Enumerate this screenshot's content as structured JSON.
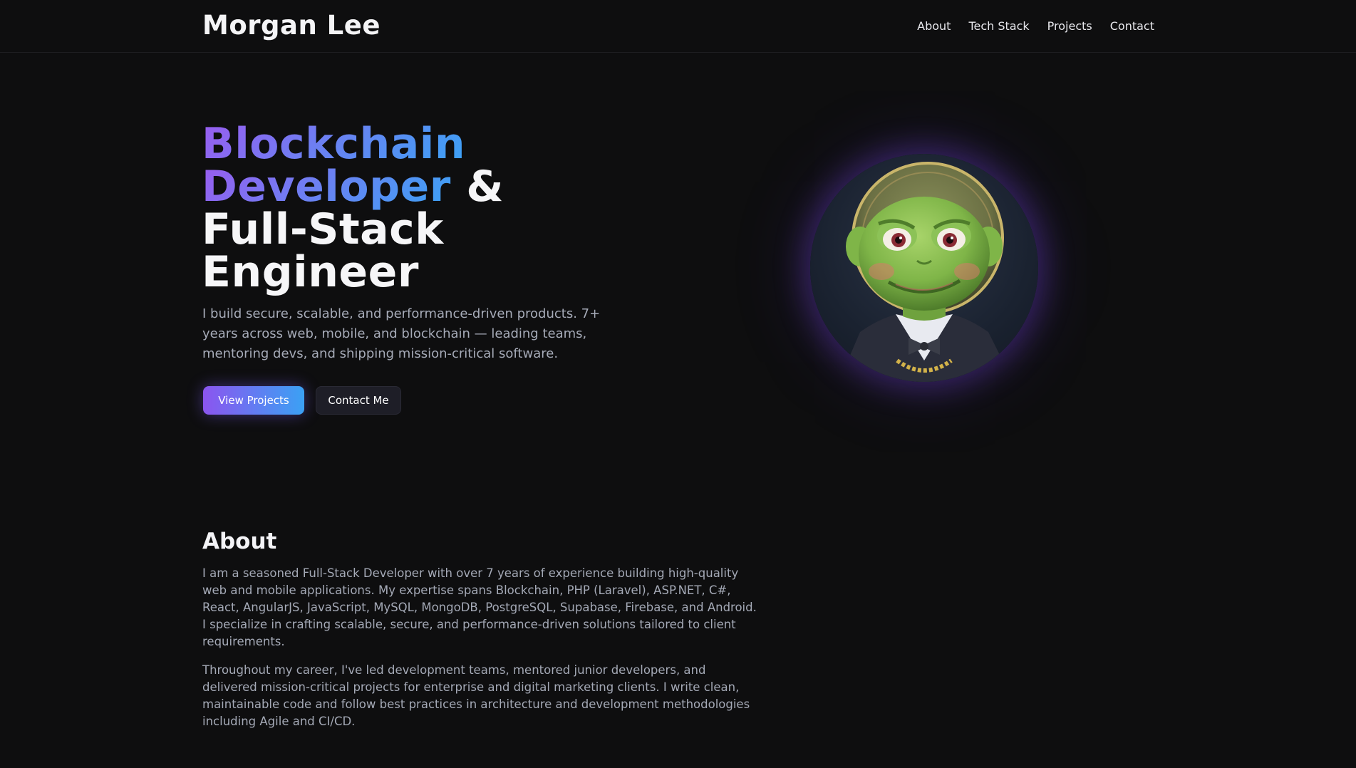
{
  "header": {
    "brand": "Morgan Lee",
    "nav": [
      {
        "label": "About"
      },
      {
        "label": "Tech Stack"
      },
      {
        "label": "Projects"
      },
      {
        "label": "Contact"
      }
    ]
  },
  "hero": {
    "title_gradient_1": "Blockchain",
    "title_gradient_2": "Developer",
    "title_amp": " &",
    "title_line_3": "Full-Stack",
    "title_line_4": "Engineer",
    "description": "I build secure, scalable, and performance-driven products. 7+ years across web, mobile, and blockchain — leading teams, mentoring devs, and shipping mission-critical software.",
    "primary_button": "View Projects",
    "secondary_button": "Contact Me",
    "avatar_icon": "avatar-portrait"
  },
  "about": {
    "title": "About",
    "paragraph_1": "I am a seasoned Full-Stack Developer with over 7 years of experience building high-quality web and mobile applications. My expertise spans Blockchain, PHP (Laravel), ASP.NET, C#, React, AngularJS, JavaScript, MySQL, MongoDB, PostgreSQL, Supabase, Firebase, and Android. I specialize in crafting scalable, secure, and performance-driven solutions tailored to client requirements.",
    "paragraph_2": "Throughout my career, I've led development teams, mentored junior developers, and delivered mission-critical projects for enterprise and digital marketing clients. I write clean, maintainable code and follow best practices in architecture and development methodologies including Agile and CI/CD."
  },
  "colors": {
    "background": "#0e0e0f",
    "accent_purple": "#8b55ef",
    "accent_blue": "#3ba1f4",
    "text_muted": "#a6abb8"
  }
}
